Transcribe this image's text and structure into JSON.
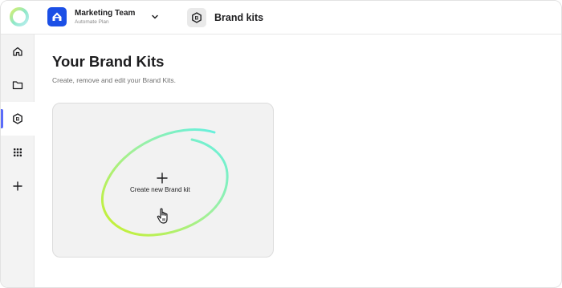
{
  "header": {
    "team_name": "Marketing Team",
    "team_plan": "Automate Plan",
    "page_name": "Brand kits"
  },
  "sidebar": {
    "items": [
      {
        "icon": "home-icon",
        "active": false
      },
      {
        "icon": "folder-icon",
        "active": false
      },
      {
        "icon": "brand-kit-icon",
        "active": true
      },
      {
        "icon": "apps-grid-icon",
        "active": false
      },
      {
        "icon": "plus-icon",
        "active": false
      }
    ]
  },
  "main": {
    "title": "Your Brand Kits",
    "subtitle": "Create, remove and edit your Brand Kits.",
    "create_card": {
      "label": "Create new Brand kit"
    }
  },
  "colors": {
    "accent": "#5b6cf9",
    "team_icon": "#1b4fe6",
    "scribble_start": "#c9f02a",
    "scribble_end": "#5ef0e6"
  }
}
